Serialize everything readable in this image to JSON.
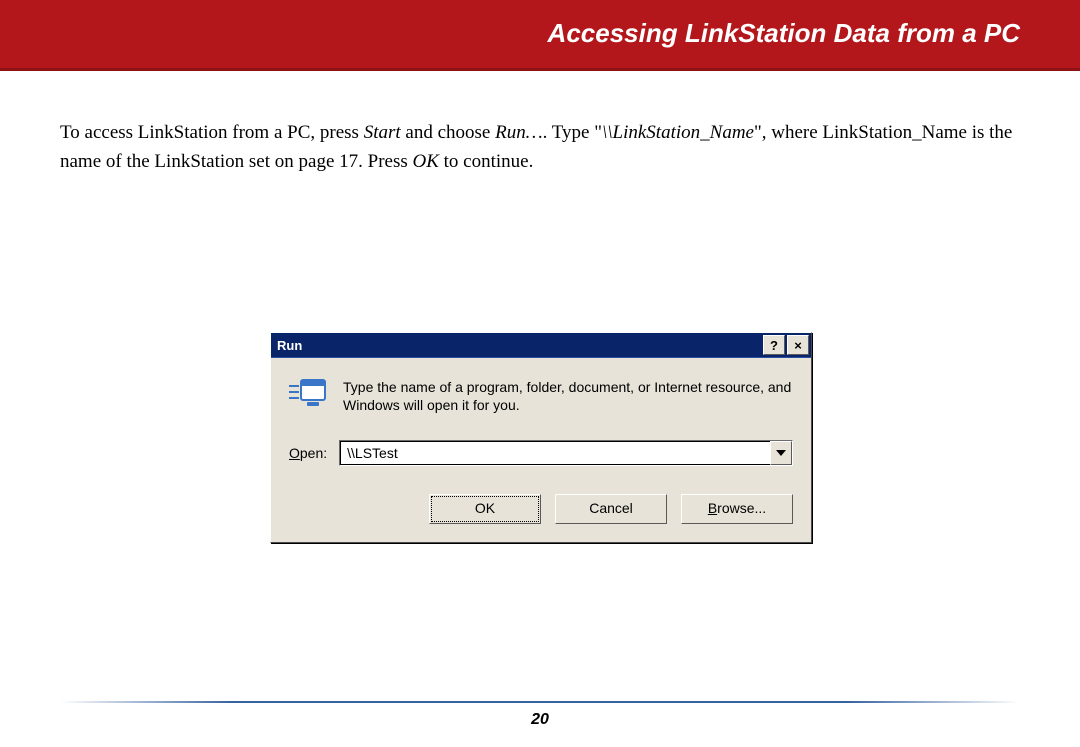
{
  "header": {
    "title": "Accessing LinkStation Data from a PC"
  },
  "body": {
    "p1_a": "To access LinkStation from a PC, press ",
    "p1_start": "Start",
    "p1_b": " and choose ",
    "p1_run": "Run…",
    "p1_c": ".   Type \"",
    "p1_path": "\\\\LinkStation_Name",
    "p1_d": "\",  where LinkStation_Name is the name of the LinkStation set on page 17.  Press ",
    "p1_ok": "OK",
    "p1_e": " to continue."
  },
  "dialog": {
    "title": "Run",
    "help_glyph": "?",
    "close_glyph": "×",
    "instruction": "Type the name of a program, folder, document, or Internet resource, and Windows will open it for you.",
    "open_label_u": "O",
    "open_label_rest": "pen:",
    "input_value": "\\\\LSTest",
    "ok_label": "OK",
    "cancel_label": "Cancel",
    "browse_u": "B",
    "browse_rest": "rowse..."
  },
  "footer": {
    "page_number": "20"
  }
}
